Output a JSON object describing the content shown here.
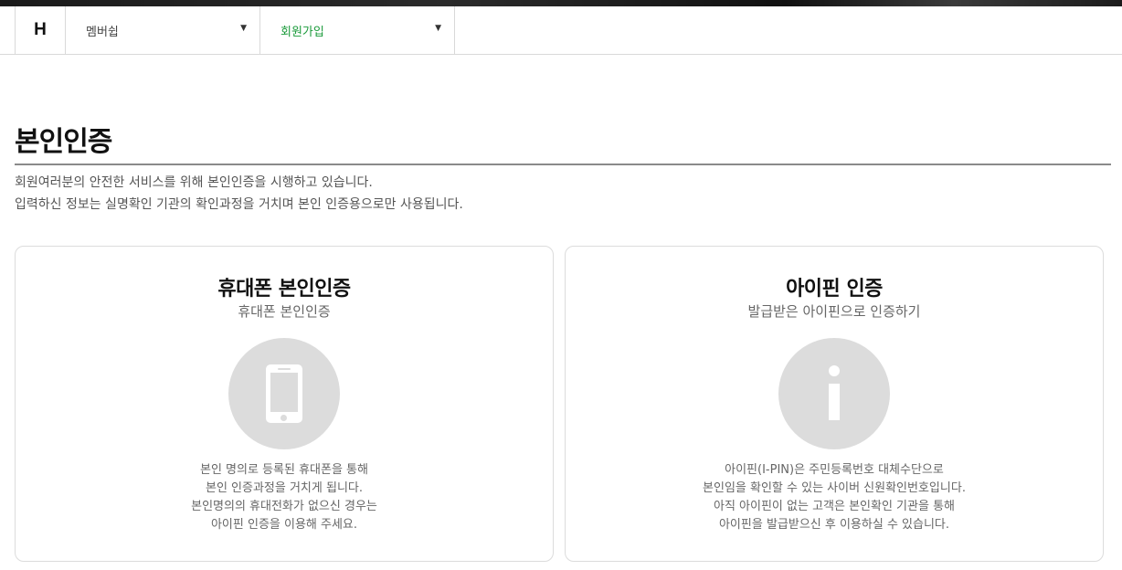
{
  "nav": {
    "logo": "H",
    "menu1": "멤버쉽",
    "menu2": "회원가입",
    "caret": "▼"
  },
  "page": {
    "title": "본인인증",
    "desc_line1": "회원여러분의 안전한 서비스를 위해 본인인증을 시행하고 있습니다.",
    "desc_line2": "입력하신 정보는 실명확인 기관의 확인과정을 거치며 본인 인증용으로만 사용됩니다."
  },
  "cards": [
    {
      "title": "휴대폰 본인인증",
      "subtitle": "휴대폰 본인인증",
      "icon": "mobile-phone-icon",
      "lines": [
        "본인 명의로 등록된 휴대폰을 통해",
        "본인 인증과정을 거치게 됩니다.",
        "본인명의의 휴대전화가 없으신 경우는",
        "아이핀 인증을 이용해 주세요."
      ]
    },
    {
      "title": "아이핀 인증",
      "subtitle": "발급받은 아이핀으로 인증하기",
      "icon": "info-icon",
      "lines": [
        "아이핀(I-PIN)은 주민등록번호 대체수단으로",
        "본인임을 확인할 수 있는 사이버 신원확인번호입니다.",
        "아직 아이핀이 없는 고객은 본인확인 기관을 통해",
        "아이핀을 발급받으신 후 이용하실 수 있습니다."
      ]
    }
  ],
  "colors": {
    "accent_green": "#1a9a3a",
    "circle_gray": "#dcdcdc",
    "rule_gray": "#8a8a8a"
  }
}
